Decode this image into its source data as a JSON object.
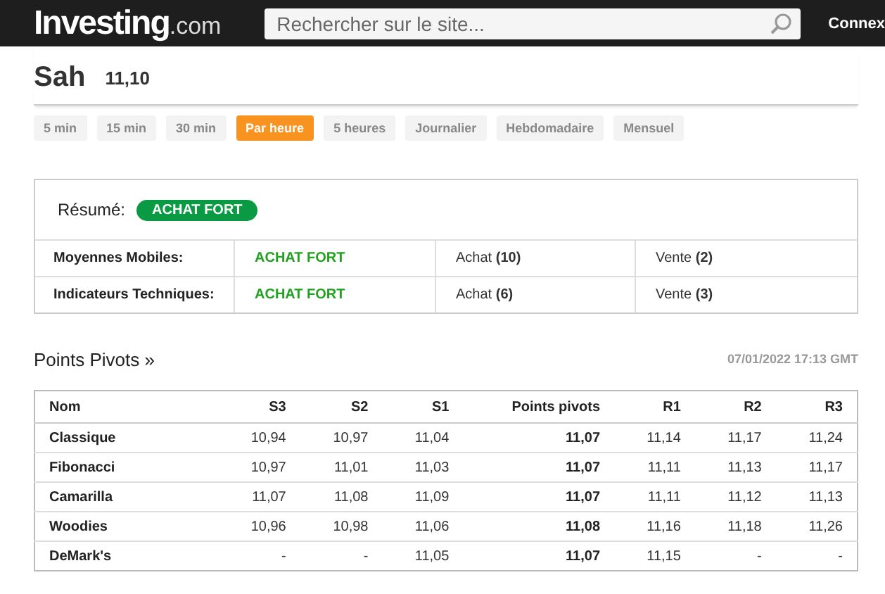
{
  "header": {
    "logo_main": "Investing",
    "logo_suffix": ".com",
    "search": {
      "placeholder": "Rechercher sur le site..."
    },
    "login": "Connex"
  },
  "instrument": {
    "name": "Sah",
    "price": "11,10"
  },
  "timeframes": [
    {
      "label": "5 min",
      "selected": false
    },
    {
      "label": "15 min",
      "selected": false
    },
    {
      "label": "30 min",
      "selected": false
    },
    {
      "label": "Par heure",
      "selected": true
    },
    {
      "label": "5 heures",
      "selected": false
    },
    {
      "label": "Journalier",
      "selected": false
    },
    {
      "label": "Hebdomadaire",
      "selected": false
    },
    {
      "label": "Mensuel",
      "selected": false
    }
  ],
  "summary": {
    "label": "Résumé:",
    "verdict": "ACHAT FORT",
    "rows": [
      {
        "name": "Moyennes Mobiles:",
        "signal": "ACHAT FORT",
        "buy": "Achat **(10)**",
        "sell": "Vente **(2)**"
      },
      {
        "name": "Indicateurs Techniques:",
        "signal": "ACHAT FORT",
        "buy": "Achat **(6)**",
        "sell": "Vente **(3)**"
      }
    ]
  },
  "pivots": {
    "title": "Points Pivots »",
    "timestamp": "07/01/2022 17:13 GMT",
    "columns": [
      "Nom",
      "S3",
      "S2",
      "S1",
      "Points pivots",
      "R1",
      "R2",
      "R3"
    ],
    "rows": [
      [
        "Classique",
        "10,94",
        "10,97",
        "11,04",
        "11,07",
        "11,14",
        "11,17",
        "11,24"
      ],
      [
        "Fibonacci",
        "10,97",
        "11,01",
        "11,03",
        "11,07",
        "11,11",
        "11,13",
        "11,17"
      ],
      [
        "Camarilla",
        "11,07",
        "11,08",
        "11,09",
        "11,07",
        "11,11",
        "11,12",
        "11,13"
      ],
      [
        "Woodies",
        "10,96",
        "10,98",
        "11,06",
        "11,08",
        "11,16",
        "11,18",
        "11,26"
      ],
      [
        "DeMark's",
        "-",
        "-",
        "11,05",
        "11,07",
        "11,15",
        "-",
        "-"
      ]
    ]
  }
}
